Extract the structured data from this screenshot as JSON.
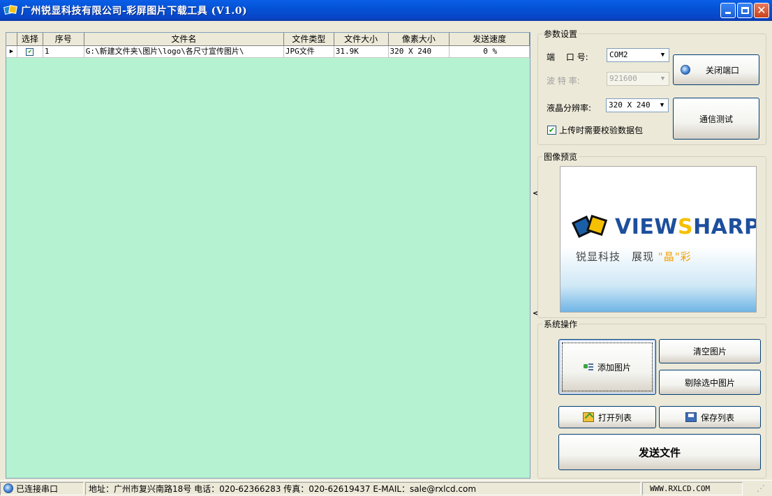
{
  "window": {
    "title": "广州锐显科技有限公司-彩屏图片下载工具 (V1.0)"
  },
  "grid": {
    "columns": [
      "选择",
      "序号",
      "文件名",
      "文件类型",
      "文件大小",
      "像素大小",
      "发送速度"
    ],
    "rows": [
      {
        "selected": true,
        "index": "1",
        "filename": "G:\\新建文件夹\\图片\\logo\\各尺寸宣传图片\\",
        "type": "JPG文件",
        "size": "31.9K",
        "pixels": "320 X 240",
        "speed": "0 %"
      }
    ]
  },
  "params": {
    "group_label": "参数设置",
    "port_label": "端　 口 号:",
    "port_value": "COM2",
    "baud_label": "波 特 率:",
    "baud_value": "921600",
    "lcd_label": "液晶分辨率:",
    "lcd_value": "320 X 240",
    "verify_label": "上传时需要校验数据包",
    "verify_checked": true,
    "close_port_button": "关闭端口",
    "comm_test_button": "通信测试"
  },
  "preview": {
    "group_label": "图像预览",
    "logo_word_a": "VIEW",
    "logo_word_accent": "S",
    "logo_word_b": "HARP",
    "logo_sub_a": "锐显科技　展现",
    "logo_sub_q": "\"晶\"",
    "logo_sub_b": "彩"
  },
  "ops": {
    "group_label": "系统操作",
    "add_image": "添加图片",
    "clear_images": "清空图片",
    "remove_selected": "剔除选中图片",
    "open_list": "打开列表",
    "save_list": "保存列表",
    "send_file": "发送文件"
  },
  "status": {
    "connection": "已连接串口",
    "contact": "地址：广州市复兴南路18号 电话：020-62366283 传真：020-62619437 E-MAIL：sale@rxlcd.com",
    "website": "WWW.RXLCD.COM"
  },
  "colors": {
    "grid_background": "#b5f2d1",
    "titlebar": "#0452d6",
    "logo_blue": "#1d4f9c",
    "logo_yellow": "#f5c000"
  }
}
